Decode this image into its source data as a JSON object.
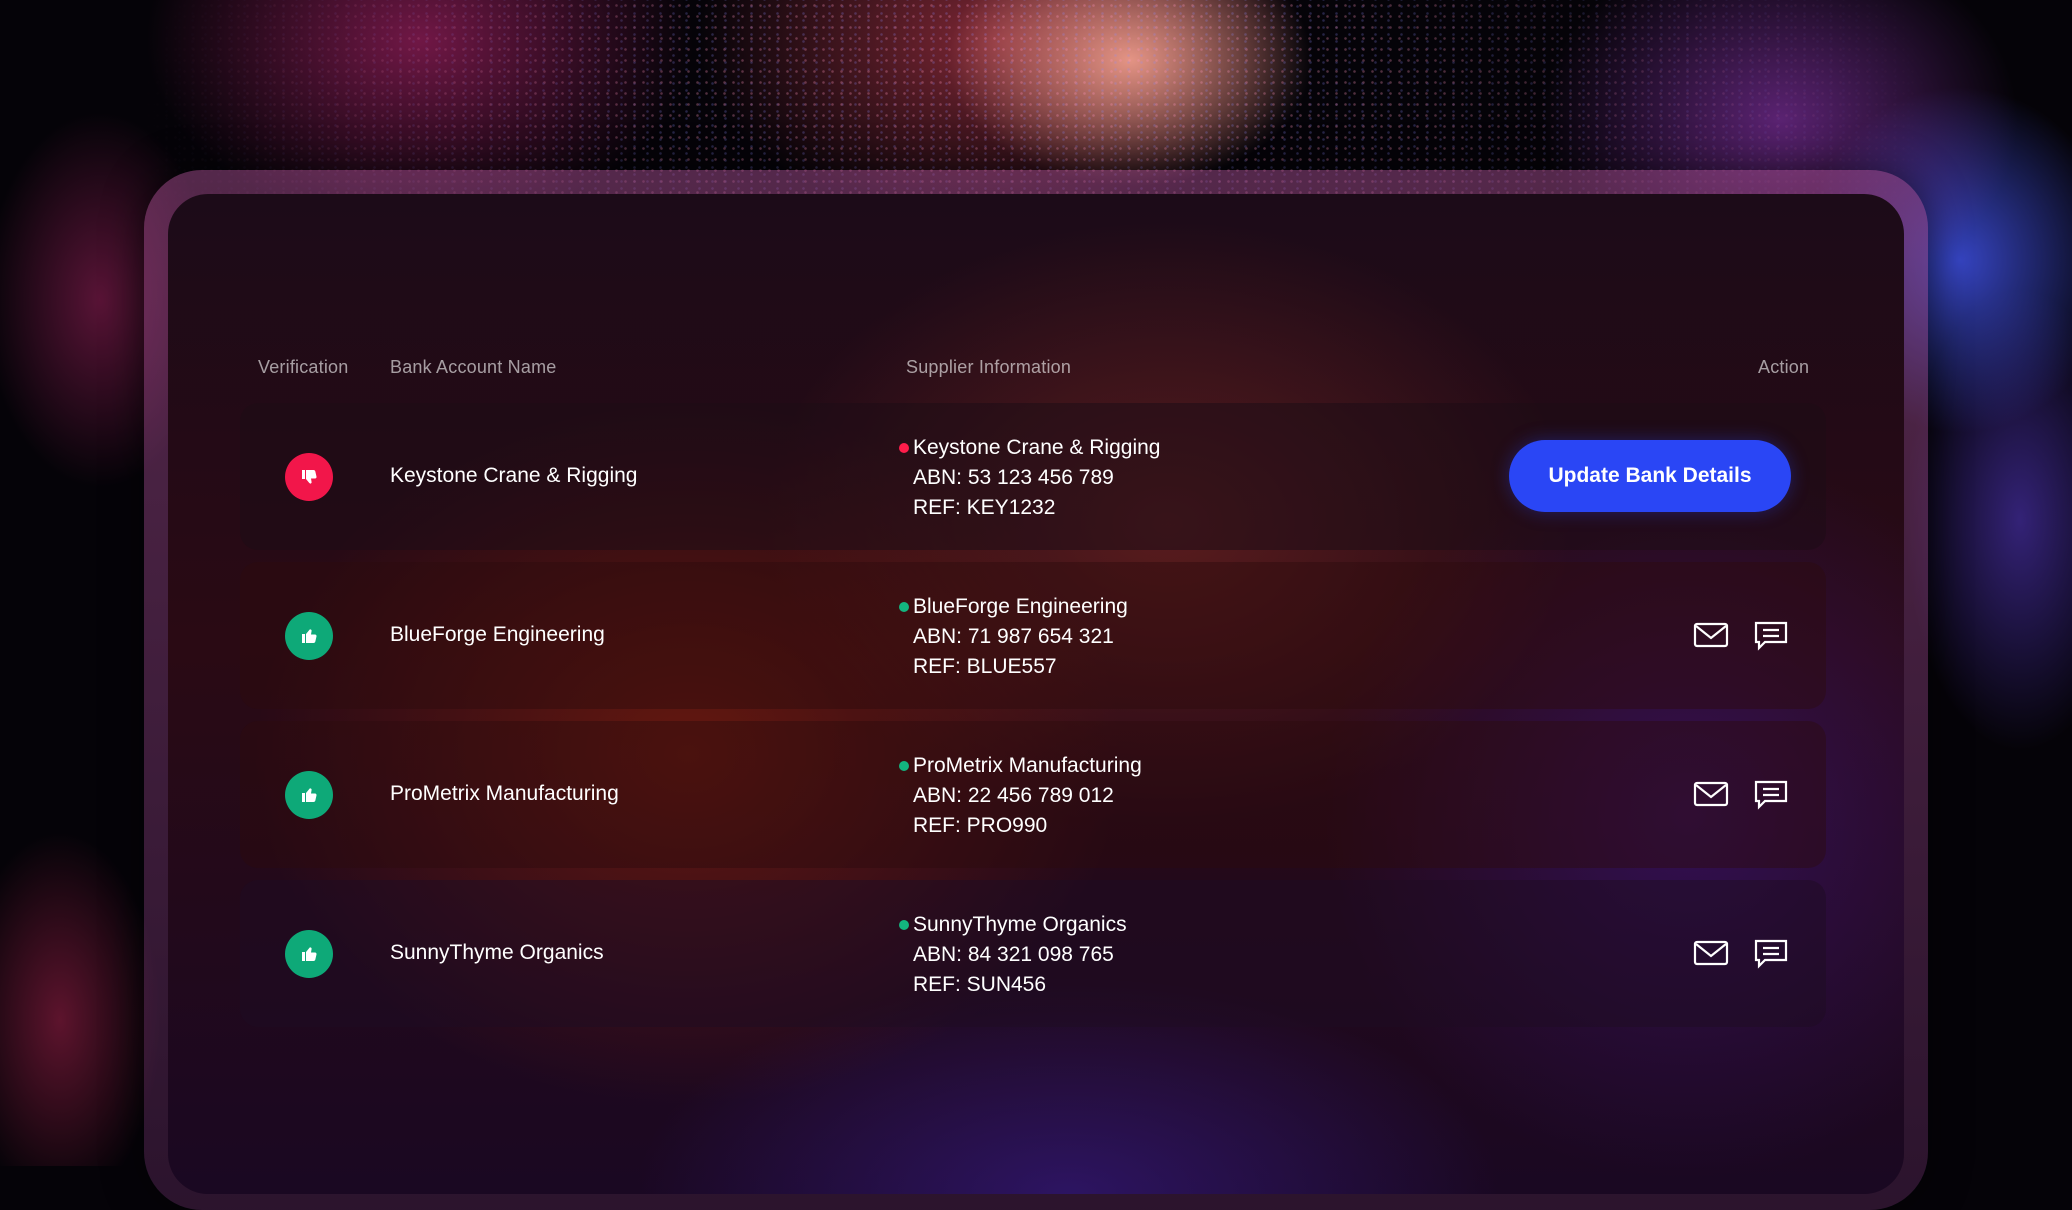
{
  "table": {
    "headers": {
      "verification": "Verification",
      "bank_account_name": "Bank Account Name",
      "supplier_information": "Supplier Information",
      "action": "Action"
    },
    "rows": [
      {
        "verification_status": "rejected",
        "verification_icon": "thumbs-down-icon",
        "bank_account_name": "Keystone Crane & Rigging",
        "supplier_name": "Keystone Crane & Rigging",
        "status_dot_color": "#ff1d4b",
        "abn": "ABN: 53 123 456 789",
        "ref": "REF: KEY1232",
        "action_label": "Update Bank Details"
      },
      {
        "verification_status": "verified",
        "verification_icon": "thumbs-up-icon",
        "bank_account_name": "BlueForge Engineering",
        "supplier_name": "BlueForge Engineering",
        "status_dot_color": "#13b57f",
        "abn": "ABN: 71 987 654 321",
        "ref": "REF: BLUE557",
        "actions": [
          "mail-icon",
          "chat-icon"
        ]
      },
      {
        "verification_status": "verified",
        "verification_icon": "thumbs-up-icon",
        "bank_account_name": "ProMetrix Manufacturing",
        "supplier_name": "ProMetrix Manufacturing",
        "status_dot_color": "#13b57f",
        "abn": "ABN: 22 456 789 012",
        "ref": "REF: PRO990",
        "actions": [
          "mail-icon",
          "chat-icon"
        ]
      },
      {
        "verification_status": "verified",
        "verification_icon": "thumbs-up-icon",
        "bank_account_name": "SunnyThyme Organics",
        "supplier_name": "SunnyThyme Organics",
        "status_dot_color": "#13b57f",
        "abn": "ABN: 84 321 098 765",
        "ref": "REF: SUN456",
        "actions": [
          "mail-icon",
          "chat-icon"
        ]
      }
    ]
  },
  "colors": {
    "primary_button": "#2a46f5",
    "rejected": "#f2164a",
    "verified": "#0ea978"
  }
}
